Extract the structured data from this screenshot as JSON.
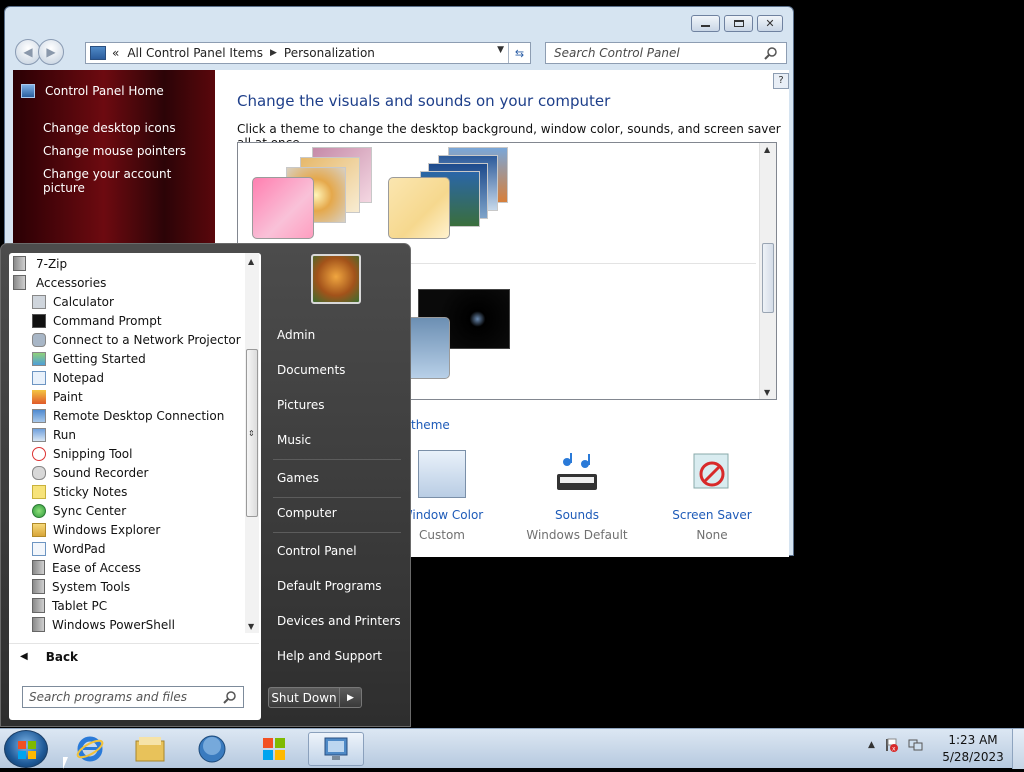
{
  "window": {
    "controls": {
      "minimize": "minimize",
      "maximize": "maximize",
      "close": "✕"
    },
    "address": {
      "prefix": "«",
      "crumbs": [
        "All Control Panel Items",
        "Personalization"
      ],
      "refresh_glyph": "⇆"
    },
    "search_placeholder": "Search Control Panel",
    "sidebar": {
      "home": "Control Panel Home",
      "links": [
        "Change desktop icons",
        "Change mouse pointers",
        "Change your account picture"
      ]
    },
    "content": {
      "help": "?",
      "heading": "Change the visuals and sounds on your computer",
      "subtext": "Click a theme to change the desktop background, window color, sounds, and screen saver all at once.",
      "link_partial": "theme",
      "settings": [
        {
          "label": "Window Color",
          "sub": "Custom"
        },
        {
          "label": "Sounds",
          "sub": "Windows Default"
        },
        {
          "label": "Screen Saver",
          "sub": "None"
        }
      ]
    }
  },
  "start_menu": {
    "programs": [
      {
        "label": "7-Zip",
        "type": "folder"
      },
      {
        "label": "Accessories",
        "type": "folder"
      },
      {
        "label": "Calculator",
        "type": "app"
      },
      {
        "label": "Command Prompt",
        "type": "app"
      },
      {
        "label": "Connect to a Network Projector",
        "type": "app"
      },
      {
        "label": "Getting Started",
        "type": "app"
      },
      {
        "label": "Notepad",
        "type": "app"
      },
      {
        "label": "Paint",
        "type": "app"
      },
      {
        "label": "Remote Desktop Connection",
        "type": "app"
      },
      {
        "label": "Run",
        "type": "app"
      },
      {
        "label": "Snipping Tool",
        "type": "app"
      },
      {
        "label": "Sound Recorder",
        "type": "app"
      },
      {
        "label": "Sticky Notes",
        "type": "app"
      },
      {
        "label": "Sync Center",
        "type": "app"
      },
      {
        "label": "Windows Explorer",
        "type": "app"
      },
      {
        "label": "WordPad",
        "type": "app"
      },
      {
        "label": "Ease of Access",
        "type": "folder"
      },
      {
        "label": "System Tools",
        "type": "folder"
      },
      {
        "label": "Tablet PC",
        "type": "folder"
      },
      {
        "label": "Windows PowerShell",
        "type": "folder"
      }
    ],
    "back": "Back",
    "search_placeholder": "Search programs and files",
    "right": [
      "Admin",
      "Documents",
      "Pictures",
      "Music",
      "Games",
      "Computer",
      "Control Panel",
      "Default Programs",
      "Devices and Printers",
      "Help and Support"
    ],
    "shutdown": "Shut Down"
  },
  "taskbar": {
    "time": "1:23 AM",
    "date": "5/28/2023"
  },
  "colors": {
    "heading_blue": "#1e3f8a",
    "link_blue": "#1e5bb8",
    "sidebar_red": "#6d0a10"
  }
}
